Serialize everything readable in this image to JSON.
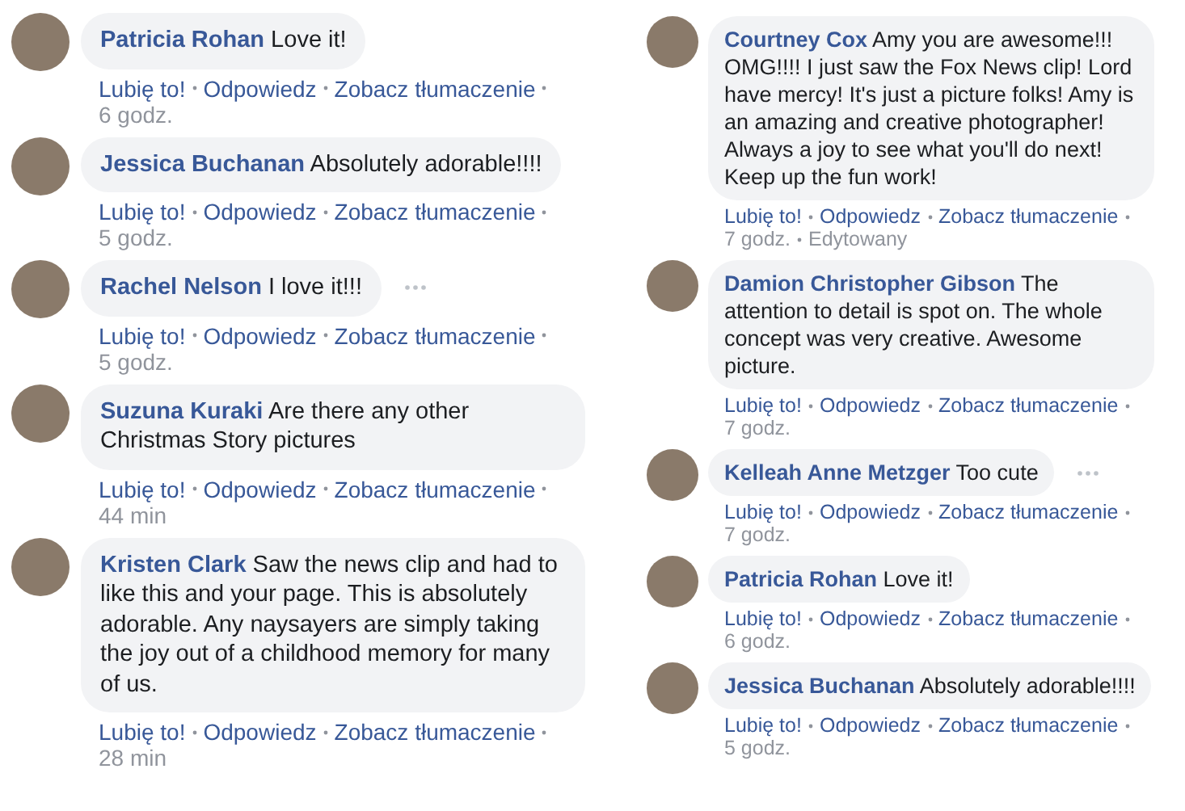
{
  "columns": [
    {
      "comments": [
        {
          "author": "Patricia Rohan",
          "text": "Love it!",
          "actions": [
            "Lubię to!",
            "Odpowiedz",
            "Zobacz tłumaczenie"
          ],
          "time": "6 godz.",
          "menu_icon": false
        },
        {
          "author": "Jessica Buchanan",
          "text": "Absolutely adorable!!!!",
          "actions": [
            "Lubię to!",
            "Odpowiedz",
            "Zobacz tłumaczenie"
          ],
          "time": "5 godz.",
          "menu_icon": false
        },
        {
          "author": "Rachel Nelson",
          "text": "I love it!!!",
          "actions": [
            "Lubię to!",
            "Odpowiedz",
            "Zobacz tłumaczenie"
          ],
          "time": "5 godz.",
          "menu_icon": true
        },
        {
          "author": "Suzuna Kuraki",
          "text": "Are there any other Christmas Story pictures",
          "actions": [
            "Lubię to!",
            "Odpowiedz",
            "Zobacz tłumaczenie"
          ],
          "time": "44 min",
          "menu_icon": false
        },
        {
          "author": "Kristen Clark",
          "text": "Saw the news clip and had to like this and your page. This is absolutely adorable. Any naysayers are simply taking the joy out of a childhood memory for many of us.",
          "actions": [
            "Lubię to!",
            "Odpowiedz",
            "Zobacz tłumaczenie"
          ],
          "time": "28 min",
          "menu_icon": false
        }
      ]
    },
    {
      "comments": [
        {
          "author": "Courtney Cox",
          "text": "Amy you are awesome!!! OMG!!!! I just saw the Fox News clip! Lord have mercy! It's just a picture folks! Amy is an amazing and creative photographer! Always a joy to see what you'll do next! Keep up the fun work!",
          "actions": [
            "Lubię to!",
            "Odpowiedz",
            "Zobacz tłumaczenie"
          ],
          "time": "7 godz.",
          "edited": "Edytowany",
          "menu_icon": false
        },
        {
          "author": "Damion Christopher Gibson",
          "text": "The attention to detail is spot on. The whole concept was very creative. Awesome picture.",
          "actions": [
            "Lubię to!",
            "Odpowiedz",
            "Zobacz tłumaczenie"
          ],
          "time": "7 godz.",
          "menu_icon": false
        },
        {
          "author": "Kelleah Anne Metzger",
          "text": "Too cute",
          "actions": [
            "Lubię to!",
            "Odpowiedz",
            "Zobacz tłumaczenie"
          ],
          "time": "7 godz.",
          "menu_icon": true
        },
        {
          "author": "Patricia Rohan",
          "text": "Love it!",
          "actions": [
            "Lubię to!",
            "Odpowiedz",
            "Zobacz tłumaczenie"
          ],
          "time": "6 godz.",
          "menu_icon": false
        },
        {
          "author": "Jessica Buchanan",
          "text": "Absolutely adorable!!!!",
          "actions": [
            "Lubię to!",
            "Odpowiedz",
            "Zobacz tłumaczenie"
          ],
          "time": "5 godz.",
          "menu_icon": false
        }
      ]
    }
  ]
}
